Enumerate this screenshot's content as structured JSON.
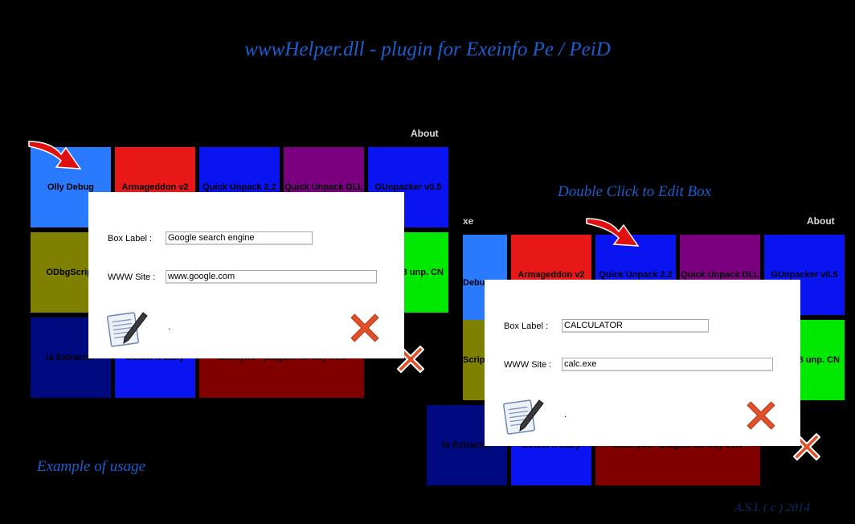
{
  "title": "wwwHelper.dll - plugin for Exeinfo Pe / PeiD",
  "caption_left": "Example of usage",
  "caption_right": "Double Click to Edit  Box",
  "credit": "A.S.L ( c ) 2014",
  "about_label": "About",
  "window_left": {
    "tiles": [
      {
        "label": "Olly Debug",
        "color": "#2a7aff"
      },
      {
        "label": "Armageddon v2",
        "color": "#e81818"
      },
      {
        "label": "Quick Unpack 2.2",
        "color": "#0a14f0"
      },
      {
        "label": "Quick Unpack DLL",
        "color": "#7a0080"
      },
      {
        "label": "GUnpacker v0.5",
        "color": "#0a14f0"
      },
      {
        "label": "ODbgScript",
        "color": "#808000"
      },
      {
        "label": "3 unp. CN",
        "color": "#00e800"
      },
      {
        "label": "la Extractor",
        "color": "#000a80"
      },
      {
        "label": "Detect It Easy",
        "color": "#0a14f0"
      },
      {
        "label": "catchyou - plugins for olly v1.0",
        "color": "#800000"
      }
    ],
    "dialog": {
      "box_label_text": "Box Label  :",
      "box_label_value": "Google search engine",
      "www_site_text": "WWW Site  :",
      "www_site_value": "www.google.com",
      "dot": "."
    }
  },
  "window_right": {
    "tiles": [
      {
        "label": "Debug",
        "color": "#2a7aff"
      },
      {
        "label": "Armageddon v2",
        "color": "#e81818"
      },
      {
        "label": "Quick Unpack 2.2",
        "color": "#0a14f0"
      },
      {
        "label": "Quick Unpack DLL",
        "color": "#7a0080"
      },
      {
        "label": "GUnpacker v0.5",
        "color": "#0a14f0"
      },
      {
        "label": "Scrip",
        "color": "#808000"
      },
      {
        "label": "3 unp. CN",
        "color": "#00e800"
      },
      {
        "label": "la Extractor",
        "color": "#000a80"
      },
      {
        "label": "Detect It Easy",
        "color": "#0a14f0"
      },
      {
        "label": "catchyou - plugins for olly v1.0",
        "color": "#800000"
      }
    ],
    "partial_title": "xe",
    "dialog": {
      "box_label_text": "Box Label  :",
      "box_label_value": "CALCULATOR",
      "www_site_text": "WWW Site  :",
      "www_site_value": "calc.exe",
      "dot": "."
    }
  },
  "icons": {
    "edit": "notepad-pen-icon",
    "close": "red-x-icon",
    "pointer": "red-arrow-icon"
  }
}
